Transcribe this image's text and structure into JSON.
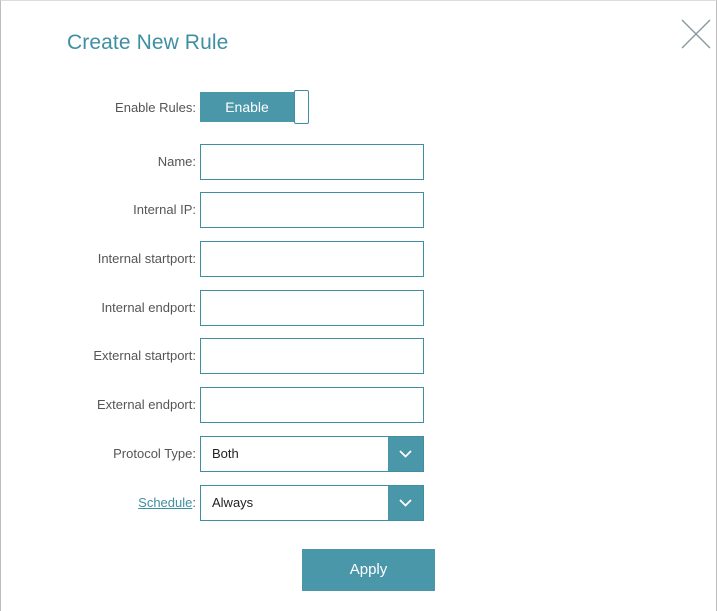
{
  "dialog": {
    "title": "Create New Rule"
  },
  "form": {
    "enable": {
      "label": "Enable Rules:",
      "state_label": "Enable"
    },
    "name": {
      "label": "Name:",
      "value": ""
    },
    "internal_ip": {
      "label": "Internal IP:",
      "value": ""
    },
    "internal_startport": {
      "label": "Internal startport:",
      "value": ""
    },
    "internal_endport": {
      "label": "Internal endport:",
      "value": ""
    },
    "external_startport": {
      "label": "External startport:",
      "value": ""
    },
    "external_endport": {
      "label": "External endport:",
      "value": ""
    },
    "protocol": {
      "label": "Protocol Type:",
      "value": "Both"
    },
    "schedule": {
      "link": "Schedule",
      "colon": ":",
      "value": "Always"
    }
  },
  "actions": {
    "apply_label": "Apply"
  },
  "icons": {
    "close": "close-icon",
    "dropdown": "chevron-down-icon"
  },
  "colors": {
    "accent": "#4a97aa",
    "title": "#3f8fa3"
  }
}
